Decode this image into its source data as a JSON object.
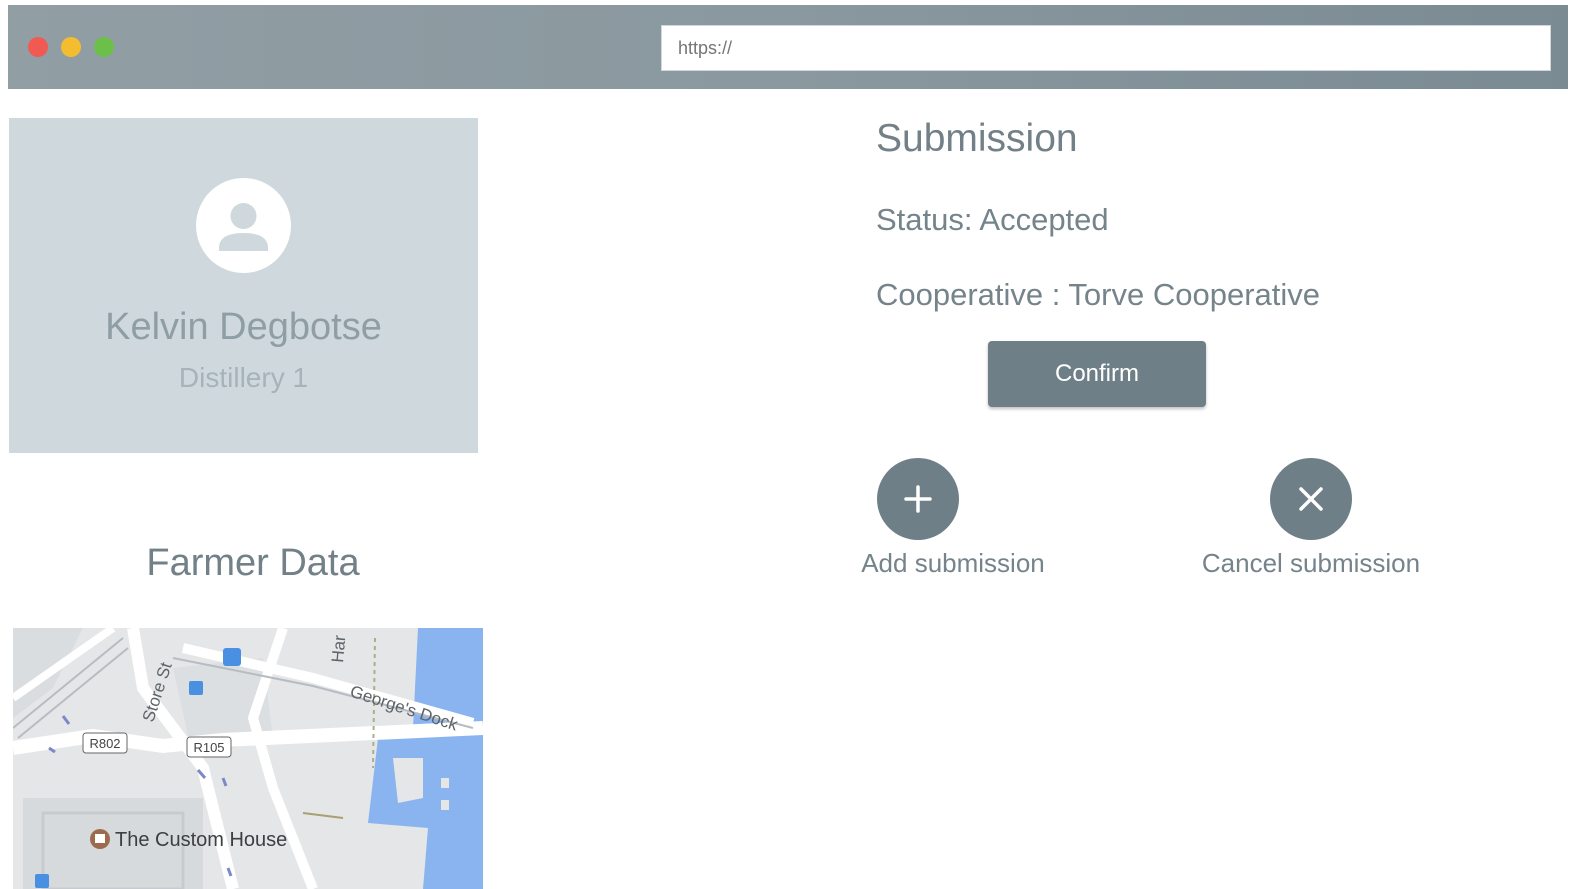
{
  "browser": {
    "url_placeholder": "https://"
  },
  "profile": {
    "name": "Kelvin Degbotse",
    "role": "Distillery 1"
  },
  "farmer_section": {
    "title": "Farmer Data"
  },
  "map": {
    "street_labels": [
      "Store St",
      "George's Dock",
      "Har"
    ],
    "road_badges": [
      "R802",
      "R105"
    ],
    "poi": "The Custom House"
  },
  "submission": {
    "title": "Submission",
    "status": "Status: Accepted",
    "cooperative": "Cooperative : Torve Cooperative",
    "confirm_label": "Confirm",
    "add_label": "Add submission",
    "cancel_label": "Cancel submission"
  },
  "colors": {
    "chrome": "#8a989f",
    "card": "#cfd8dc",
    "button": "#6e7f87",
    "text": "#75838b"
  }
}
